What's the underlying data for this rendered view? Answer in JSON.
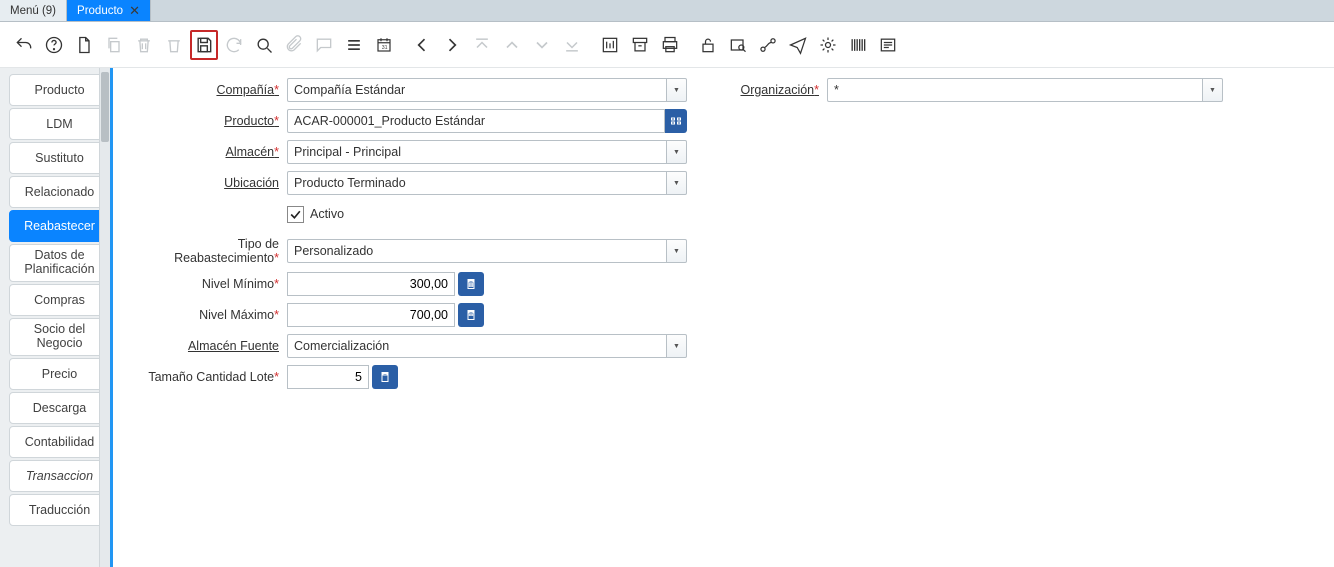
{
  "tabs": {
    "menu": "Menú (9)",
    "producto": "Producto"
  },
  "vtabs": [
    "Producto",
    "LDM",
    "Sustituto",
    "Relacionado",
    "Reabastecer",
    "Datos de Planificación",
    "Compras",
    "Socio del Negocio",
    "Precio",
    "Descarga",
    "Contabilidad",
    "Transaccion",
    "Traducción"
  ],
  "labels": {
    "compania": "Compañía",
    "organizacion": "Organización",
    "producto": "Producto",
    "almacen": "Almacén",
    "ubicacion": "Ubicación",
    "activo": "Activo",
    "tipo_reabast": "Tipo de Reabastecimiento",
    "nivel_min": "Nivel Mínimo",
    "nivel_max": "Nivel Máximo",
    "almacen_fuente": "Almacén Fuente",
    "tamano_lote": "Tamaño Cantidad Lote"
  },
  "values": {
    "compania": "Compañía Estándar",
    "organizacion": "*",
    "producto": "ACAR-000001_Producto Estándar",
    "almacen": "Principal - Principal",
    "ubicacion": "Producto Terminado",
    "tipo_reabast": "Personalizado",
    "nivel_min": "300,00",
    "nivel_max": "700,00",
    "almacen_fuente": "Comercialización",
    "tamano_lote": "5"
  }
}
